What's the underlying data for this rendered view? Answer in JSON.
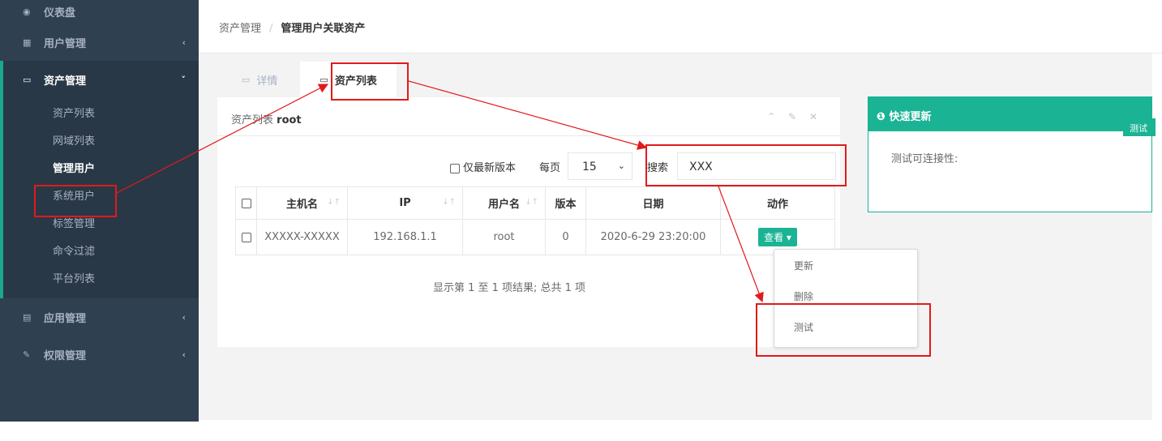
{
  "sidebar": {
    "items": [
      {
        "label": "仪表盘",
        "icon": "dashboard-icon",
        "glyph": "◉"
      },
      {
        "label": "用户管理",
        "icon": "users-icon",
        "glyph": "▦",
        "chevron": "‹"
      },
      {
        "label": "资产管理",
        "icon": "inbox-icon",
        "glyph": "▭",
        "chevron": "˅"
      },
      {
        "label": "应用管理",
        "icon": "grid-icon",
        "glyph": "▤",
        "chevron": "‹"
      },
      {
        "label": "权限管理",
        "icon": "edit-icon",
        "glyph": "✎",
        "chevron": "‹"
      }
    ],
    "sub_items": [
      "资产列表",
      "网域列表",
      "管理用户",
      "系统用户",
      "标签管理",
      "命令过滤",
      "平台列表"
    ]
  },
  "breadcrumb": {
    "parent": "资产管理",
    "separator": "/",
    "current": "管理用户关联资产"
  },
  "tabs": [
    {
      "label": "详情",
      "icon": "laptop-icon",
      "glyph": "▭"
    },
    {
      "label": "资产列表",
      "icon": "laptop-icon",
      "glyph": "▭"
    }
  ],
  "panel": {
    "title_prefix": "资产列表",
    "title_bold": "root",
    "tools": "⌃ ✎ ✕",
    "filters": {
      "latest_label": "仅最新版本",
      "per_page_label": "每页",
      "per_page_value": "15",
      "per_page_caret": "⌄",
      "search_label": "搜索",
      "search_value": "XXX"
    },
    "table": {
      "headers": [
        "主机名",
        "IP",
        "用户名",
        "版本",
        "日期",
        "动作"
      ],
      "sort_glyph": "↓↑",
      "rows": [
        {
          "hostname": "XXXXX-XXXXX",
          "ip": "192.168.1.1",
          "username": "root",
          "version": "0",
          "date": "2020-6-29 23:20:00",
          "action": "查看 ▾"
        }
      ]
    },
    "summary": "显示第 1 至 1 项结果; 总共 1 项"
  },
  "action_menu": {
    "items": [
      "更新",
      "删除",
      "测试"
    ]
  },
  "quick_update": {
    "title": "快速更新",
    "icon_glyph": "❶",
    "test_label": "测试可连接性:",
    "test_button": "测试"
  },
  "colors": {
    "sidebar": "#2f4050",
    "accent": "#1ab394",
    "annotation": "#e21a1a"
  }
}
